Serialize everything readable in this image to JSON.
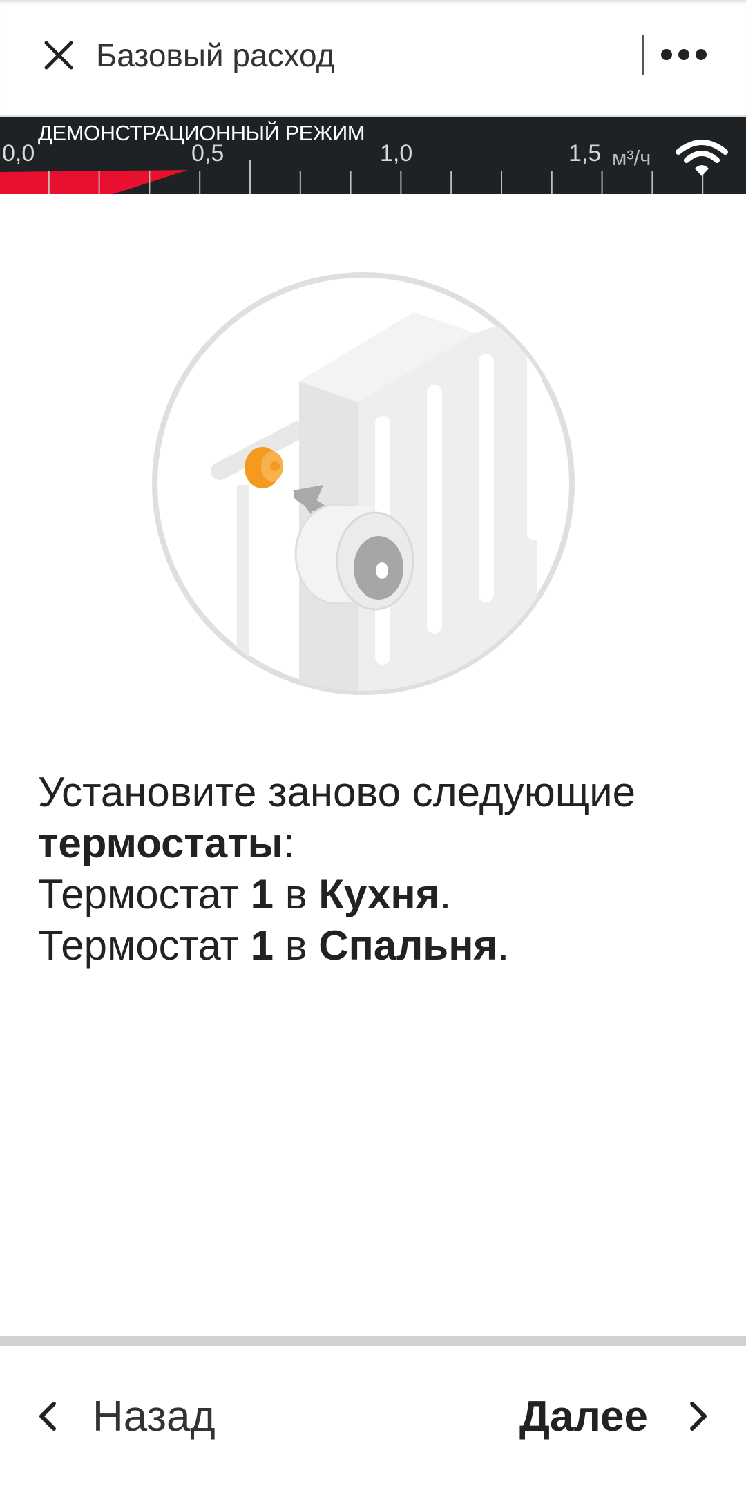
{
  "header": {
    "title": "Базовый расход",
    "close_icon": "close-icon",
    "more_icon": "more-dots-icon"
  },
  "gauge": {
    "mode_label": "ДЕМОНСТРАЦИОННЫЙ РЕЖИМ",
    "tick_labels": [
      "0,0",
      "0,5",
      "1,0",
      "1,5"
    ],
    "unit": "м³/ч",
    "scale_min": 0.0,
    "scale_max": 1.5,
    "current_value": 0.5,
    "fill_color": "#e8102e",
    "signal_icon": "wifi-icon"
  },
  "illustration": {
    "icon": "radiator-thermostat-icon",
    "accent_color": "#f39a1f"
  },
  "message": {
    "intro": "Установите заново следующие",
    "highlight": "термостаты",
    "colon": ":",
    "lines": [
      {
        "prefix": "Термостат ",
        "number": "1",
        "connector": " в ",
        "room": "Кухня",
        "end": "."
      },
      {
        "prefix": "Термостат ",
        "number": "1",
        "connector": " в ",
        "room": "Спальня",
        "end": "."
      }
    ]
  },
  "footer": {
    "back_label": "Назад",
    "next_label": "Далее",
    "back_icon": "chevron-left-icon",
    "next_icon": "chevron-right-icon"
  }
}
